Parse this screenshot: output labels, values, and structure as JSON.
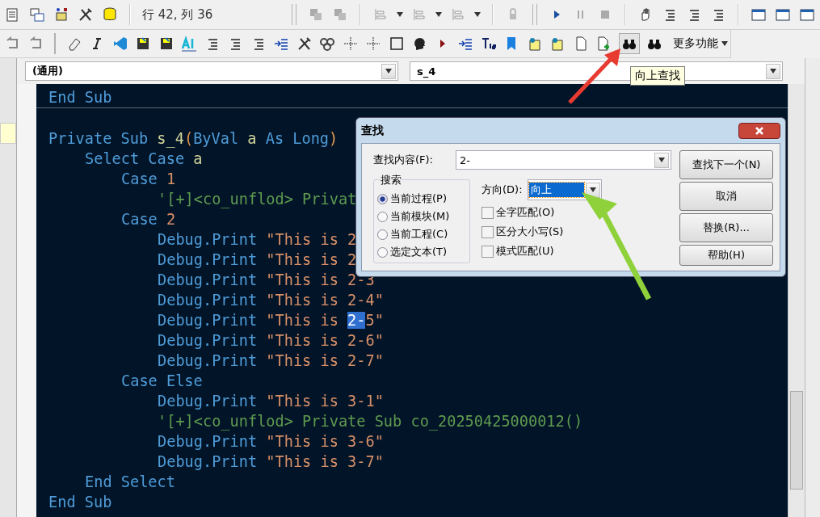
{
  "toolbar": {
    "position": "行 42, 列 36",
    "more_button": "更多功能"
  },
  "tooltip": "向上查找",
  "combos": [
    {
      "value": "(通用)"
    },
    {
      "value": "s_4"
    }
  ],
  "code_lines": [
    {
      "kind": "code",
      "rule_after": true,
      "segments": [
        {
          "kind": "keyword",
          "text": "End Sub"
        }
      ]
    },
    {
      "kind": "blank"
    },
    {
      "kind": "code",
      "segments": [
        {
          "kind": "keyword",
          "text": "Private Sub"
        },
        {
          "kind": "ident",
          "text": " s_4"
        },
        {
          "kind": "paren",
          "text": "("
        },
        {
          "kind": "keyword",
          "text": "ByVal"
        },
        {
          "kind": "ident",
          "text": " a"
        },
        {
          "kind": "keyword",
          "text": " As Long"
        },
        {
          "kind": "paren",
          "text": ")"
        }
      ],
      "children": [
        {
          "kind": "code",
          "segments": [
            {
              "kind": "keyword",
              "text": "Select Case"
            },
            {
              "kind": "ident",
              "text": " a"
            }
          ],
          "children": [
            {
              "kind": "code",
              "segments": [
                {
                  "kind": "keyword",
                  "text": "Case"
                },
                {
                  "kind": "number",
                  "text": " 1"
                }
              ],
              "children": [
                {
                  "kind": "code",
                  "segments": [
                    {
                      "kind": "comment",
                      "text": "'[+]<co_unflod> Privat"
                    }
                  ]
                }
              ]
            },
            {
              "kind": "code",
              "segments": [
                {
                  "kind": "keyword",
                  "text": "Case"
                },
                {
                  "kind": "number",
                  "text": " 2"
                }
              ],
              "children": [
                {
                  "kind": "code",
                  "segments": [
                    {
                      "kind": "keyword",
                      "text": "Debug.Print"
                    },
                    {
                      "kind": "string",
                      "text": " \"This is 2"
                    }
                  ]
                },
                {
                  "kind": "code",
                  "segments": [
                    {
                      "kind": "keyword",
                      "text": "Debug.Print"
                    },
                    {
                      "kind": "string",
                      "text": " \"This is 2"
                    }
                  ]
                },
                {
                  "kind": "code",
                  "segments": [
                    {
                      "kind": "keyword",
                      "text": "Debug.Print"
                    },
                    {
                      "kind": "string",
                      "text": " \"This is 2-3"
                    }
                  ]
                },
                {
                  "kind": "code",
                  "segments": [
                    {
                      "kind": "keyword",
                      "text": "Debug.Print"
                    },
                    {
                      "kind": "string",
                      "text": " \"This is 2-4\""
                    }
                  ]
                },
                {
                  "kind": "code",
                  "segments": [
                    {
                      "kind": "keyword",
                      "text": "Debug.Print"
                    },
                    {
                      "kind": "string",
                      "text": " \"This is "
                    },
                    {
                      "kind": "selected",
                      "text": "2-"
                    },
                    {
                      "kind": "string",
                      "text": "5\""
                    }
                  ]
                },
                {
                  "kind": "code",
                  "segments": [
                    {
                      "kind": "keyword",
                      "text": "Debug.Print"
                    },
                    {
                      "kind": "string",
                      "text": " \"This is 2-6\""
                    }
                  ]
                },
                {
                  "kind": "code",
                  "segments": [
                    {
                      "kind": "keyword",
                      "text": "Debug.Print"
                    },
                    {
                      "kind": "string",
                      "text": " \"This is 2-7\""
                    }
                  ]
                }
              ]
            },
            {
              "kind": "code",
              "segments": [
                {
                  "kind": "keyword",
                  "text": "Case Else"
                }
              ],
              "children": [
                {
                  "kind": "code",
                  "segments": [
                    {
                      "kind": "keyword",
                      "text": "Debug.Print"
                    },
                    {
                      "kind": "string",
                      "text": " \"This is 3-1\""
                    }
                  ]
                },
                {
                  "kind": "code",
                  "segments": [
                    {
                      "kind": "comment",
                      "text": "'[+]<co_unflod> Private Sub co_20250425000012()"
                    }
                  ]
                },
                {
                  "kind": "code",
                  "segments": [
                    {
                      "kind": "keyword",
                      "text": "Debug.Print"
                    },
                    {
                      "kind": "string",
                      "text": " \"This is 3-6\""
                    }
                  ]
                },
                {
                  "kind": "code",
                  "segments": [
                    {
                      "kind": "keyword",
                      "text": "Debug.Print"
                    },
                    {
                      "kind": "string",
                      "text": " \"This is 3-7\""
                    }
                  ]
                }
              ]
            }
          ]
        },
        {
          "kind": "code",
          "segments": [
            {
              "kind": "keyword",
              "text": "End Select"
            }
          ]
        }
      ]
    },
    {
      "kind": "code",
      "segments": [
        {
          "kind": "keyword",
          "text": "End Sub"
        }
      ]
    }
  ],
  "find_dialog": {
    "title": "查找",
    "find_label": "查找内容(F):",
    "find_value": "2-",
    "search_group": "搜索",
    "scopes": [
      {
        "label": "当前过程(P)",
        "selected": true
      },
      {
        "label": "当前模块(M)",
        "selected": false
      },
      {
        "label": "当前工程(C)",
        "selected": false
      },
      {
        "label": "选定文本(T)",
        "selected": false
      }
    ],
    "direction_label": "方向(D):",
    "direction_value": "向上",
    "options": [
      {
        "label": "全字匹配(O)",
        "checked": false
      },
      {
        "label": "区分大小写(S)",
        "checked": false
      },
      {
        "label": "模式匹配(U)",
        "checked": false
      }
    ],
    "buttons": [
      "查找下一个(N)",
      "取消",
      "替换(R)...",
      "帮助(H)"
    ]
  }
}
